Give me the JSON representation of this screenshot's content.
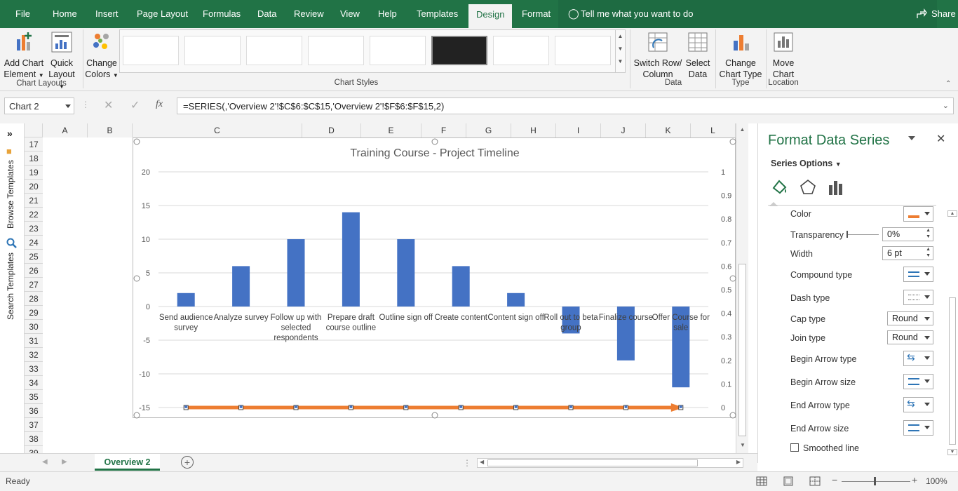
{
  "menubar": {
    "tabs": [
      "File",
      "Home",
      "Insert",
      "Page Layout",
      "Formulas",
      "Data",
      "Review",
      "View",
      "Help",
      "Templates",
      "Design",
      "Format"
    ],
    "active_tab": "Design",
    "tell_me": "Tell me what you want to do",
    "share": "Share"
  },
  "ribbon": {
    "add_chart_element": [
      "Add Chart",
      "Element"
    ],
    "quick_layout": [
      "Quick",
      "Layout"
    ],
    "chart_layouts_label": "Chart Layouts",
    "change_colors": [
      "Change",
      "Colors"
    ],
    "chart_styles_label": "Chart Styles",
    "switch_row_col": [
      "Switch Row/",
      "Column"
    ],
    "select_data": [
      "Select",
      "Data"
    ],
    "data_label": "Data",
    "change_chart_type": [
      "Change",
      "Chart Type"
    ],
    "type_label": "Type",
    "move_chart": [
      "Move",
      "Chart"
    ],
    "location_label": "Location"
  },
  "formula_bar": {
    "name_box": "Chart 2",
    "fx": "fx",
    "formula": "=SERIES(,'Overview 2'!$C$6:$C$15,'Overview 2'!$F$6:$F$15,2)"
  },
  "sidebar": {
    "browse_templates": "Browse Templates",
    "search_templates": "Search Templates"
  },
  "grid": {
    "columns": [
      "A",
      "B",
      "C",
      "D",
      "E",
      "F",
      "G",
      "H",
      "I",
      "J",
      "K",
      "L"
    ],
    "rows": [
      "17",
      "18",
      "19",
      "20",
      "21",
      "22",
      "23",
      "24",
      "25",
      "26",
      "27",
      "28",
      "29",
      "30",
      "31",
      "32",
      "33",
      "34",
      "35",
      "36",
      "37",
      "38",
      "39"
    ]
  },
  "chart_data": {
    "type": "bar",
    "title": "Training Course - Project Timeline",
    "categories": [
      "Send audience survey",
      "Analyze survey",
      "Follow up with selected respondents",
      "Prepare draft course outline",
      "Outline sign off",
      "Create content",
      "Content sign off",
      "Roll out to beta group",
      "Finalize course",
      "Offer Course for sale"
    ],
    "category_lines": [
      [
        "Send audience",
        "survey"
      ],
      [
        "Analyze survey"
      ],
      [
        "Follow up with",
        "selected",
        "respondents"
      ],
      [
        "Prepare draft",
        "course outline"
      ],
      [
        "Outline sign off"
      ],
      [
        "Create content"
      ],
      [
        "Content sign off"
      ],
      [
        "Roll out to beta",
        "group"
      ],
      [
        "Finalize course"
      ],
      [
        "Offer Course for",
        "sale"
      ]
    ],
    "series": [
      {
        "values": [
          2,
          6,
          10,
          14,
          10,
          6,
          2,
          -4,
          -8,
          -12
        ],
        "color": "#4472c4"
      },
      {
        "values": [
          0,
          0,
          0,
          0,
          0,
          0,
          0,
          0,
          0,
          0
        ],
        "color": "#ed7d31",
        "axis": "secondary"
      }
    ],
    "ylim": [
      -15,
      20
    ],
    "yticks": [
      "20",
      "15",
      "10",
      "5",
      "0",
      "-5",
      "-10",
      "-15"
    ],
    "y2lim": [
      0,
      1
    ],
    "y2ticks": [
      "1",
      "0.9",
      "0.8",
      "0.7",
      "0.6",
      "0.5",
      "0.4",
      "0.3",
      "0.2",
      "0.1",
      "0"
    ],
    "grid": true
  },
  "sheet": {
    "tab": "Overview 2"
  },
  "pane": {
    "title": "Format Data Series",
    "series_options": "Series Options",
    "color_label": "Color",
    "transparency_label": "Transparency",
    "transparency_value": "0%",
    "width_label": "Width",
    "width_value": "6 pt",
    "compound_label": "Compound type",
    "dash_label": "Dash type",
    "cap_label": "Cap type",
    "cap_value": "Round",
    "join_label": "Join type",
    "join_value": "Round",
    "begin_arrow_type_label": "Begin Arrow type",
    "begin_arrow_size_label": "Begin Arrow size",
    "end_arrow_type_label": "End Arrow type",
    "end_arrow_size_label": "End Arrow size",
    "smoothed_label": "Smoothed line",
    "color_swatch": "#ed7d31"
  },
  "status": {
    "ready": "Ready",
    "zoom": "100%"
  },
  "colors": {
    "brand": "#217346"
  }
}
